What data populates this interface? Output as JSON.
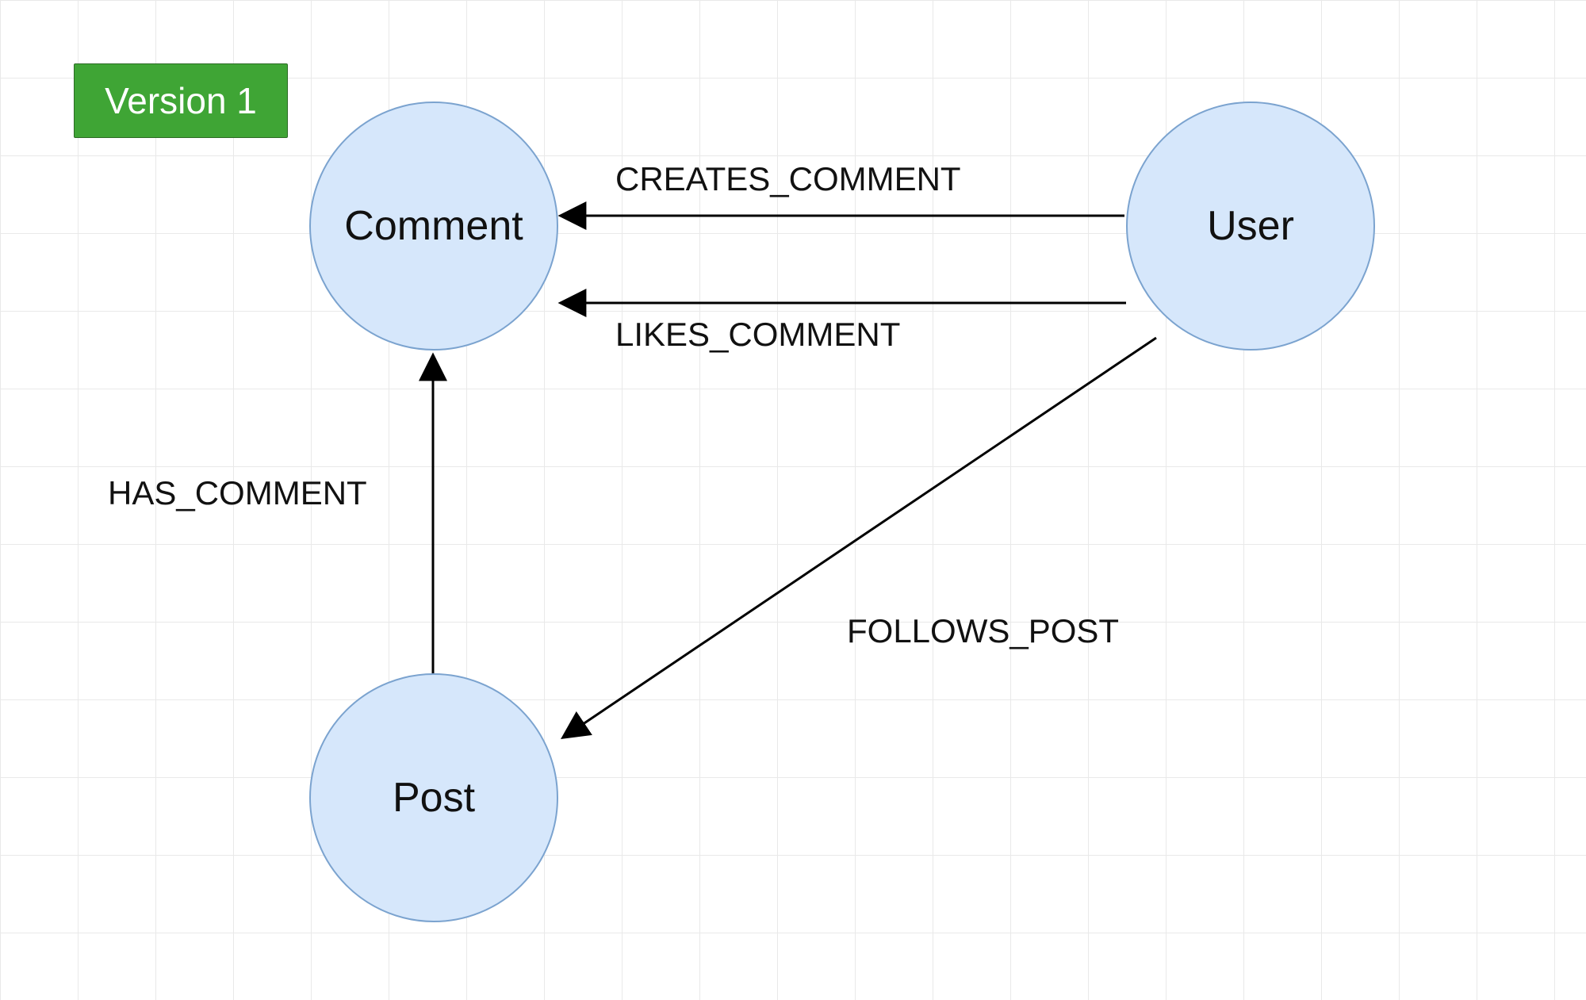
{
  "badge": {
    "label": "Version 1"
  },
  "nodes": {
    "comment": {
      "label": "Comment"
    },
    "user": {
      "label": "User"
    },
    "post": {
      "label": "Post"
    }
  },
  "edges": {
    "creates_comment": {
      "label": "CREATES_COMMENT"
    },
    "likes_comment": {
      "label": "LIKES_COMMENT"
    },
    "has_comment": {
      "label": "HAS_COMMENT"
    },
    "follows_post": {
      "label": "FOLLOWS_POST"
    }
  }
}
